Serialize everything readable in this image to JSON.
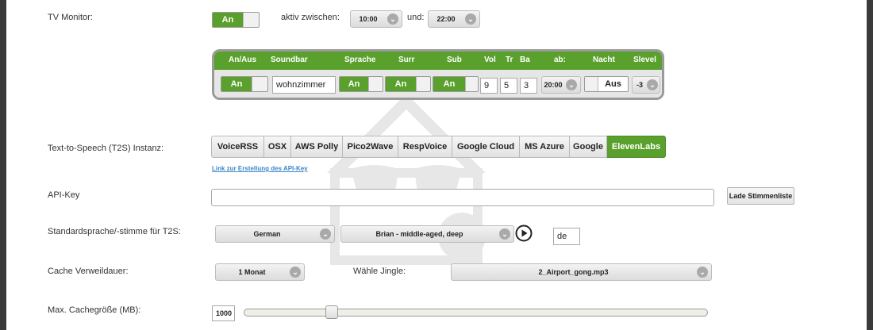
{
  "tv_monitor": {
    "label": "TV Monitor:",
    "toggle_label": "An",
    "active_between_label": "aktiv zwischen:",
    "from_time": "10:00",
    "and_label": "und:",
    "to_time": "22:00"
  },
  "soundbar": {
    "headers": [
      "An/Aus",
      "Soundbar",
      "Sprache",
      "Surr",
      "Sub",
      "Vol",
      "Tr",
      "Ba",
      "ab:",
      "Nacht",
      "Slevel"
    ],
    "row": {
      "enabled": "An",
      "name": "wohnzimmer",
      "sprache": "An",
      "surr": "An",
      "sub": "An",
      "vol": "9",
      "tr": "5",
      "ba": "3",
      "ab_time": "20:00",
      "nacht": "Aus",
      "slevel": "-3"
    }
  },
  "t2s": {
    "label": "Text-to-Speech (T2S) Instanz:",
    "tabs": [
      "VoiceRSS",
      "OSX",
      "AWS Polly",
      "Pico2Wave",
      "RespVoice",
      "Google Cloud",
      "MS Azure",
      "Google",
      "ElevenLabs"
    ],
    "active_tab": "ElevenLabs",
    "api_link": "Link zur Erstellung des API-Key"
  },
  "api_key": {
    "label": "API-Key",
    "value": "",
    "load_voices_button": "Lade Stimmenliste"
  },
  "voice": {
    "label": "Standardsprache/-stimme für T2S:",
    "language": "German",
    "voice": "Brian - middle-aged, deep",
    "code": "de"
  },
  "cache": {
    "label": "Cache Verweildauer:",
    "duration": "1 Monat",
    "jingle_label": "Wähle Jingle:",
    "jingle": "2_Airport_gong.mp3"
  },
  "max_cache": {
    "label": "Max. Cachegröße (MB):",
    "value": "1000",
    "slider_fraction": 0.18
  },
  "colors": {
    "accent": "#5aa02c",
    "frame": "#9a9a9a",
    "link": "#3a87c8"
  }
}
